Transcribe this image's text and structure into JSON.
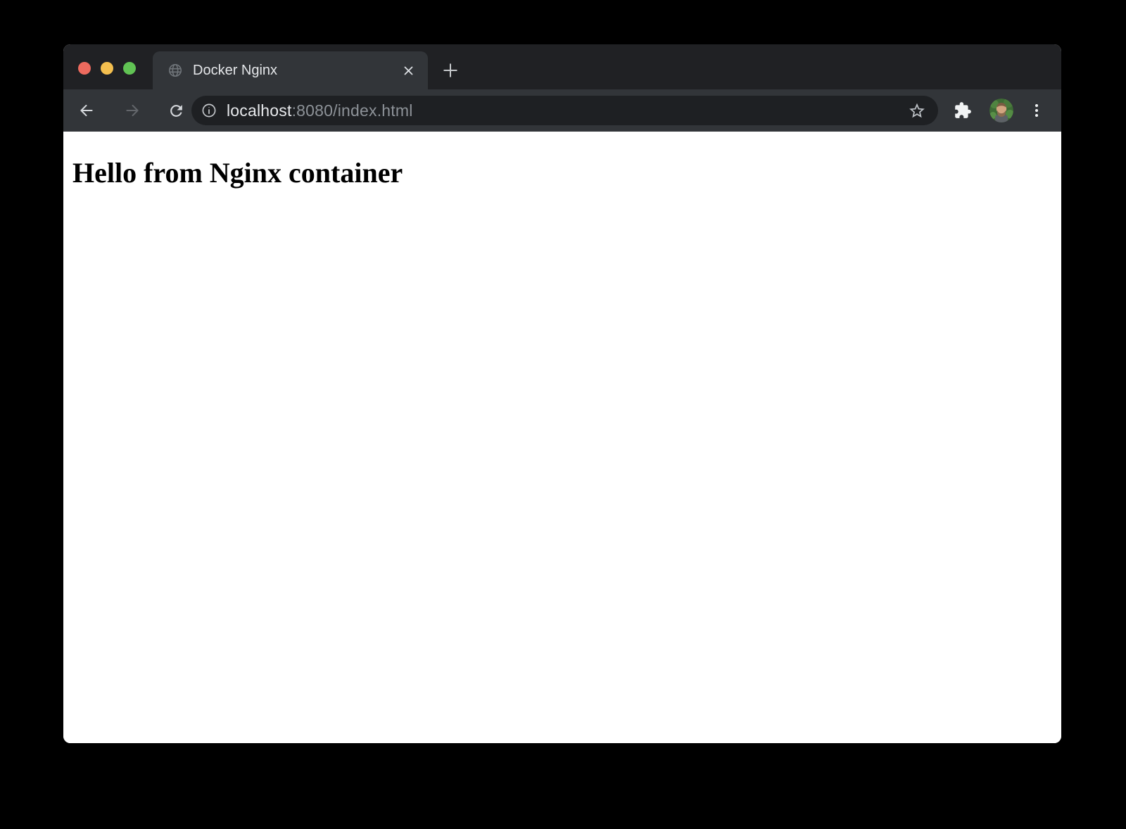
{
  "colors": {
    "desktop-bg": "#000000",
    "frame-bg": "#202124",
    "toolbar-bg": "#323539",
    "omnibox-bg": "#1e2023",
    "page-bg": "#ffffff",
    "traffic-red": "#ed6a5e",
    "traffic-yellow": "#f4bf4f",
    "traffic-green": "#61c354",
    "icon-light": "#d6d9dd",
    "icon-dim": "#63666b",
    "icon-white": "#f1f3f4",
    "tab-text": "#e4e6e9",
    "url-host": "#e8eaed",
    "url-path": "#8d9298",
    "heading-color": "#000000"
  },
  "tabstrip": {
    "tab": {
      "title": "Docker Nginx",
      "favicon": "globe-icon"
    },
    "new_tab_icon": "plus-icon"
  },
  "toolbar": {
    "url": {
      "host": "localhost",
      "path": ":8080/index.html"
    }
  },
  "page": {
    "heading": "Hello from Nginx container"
  }
}
